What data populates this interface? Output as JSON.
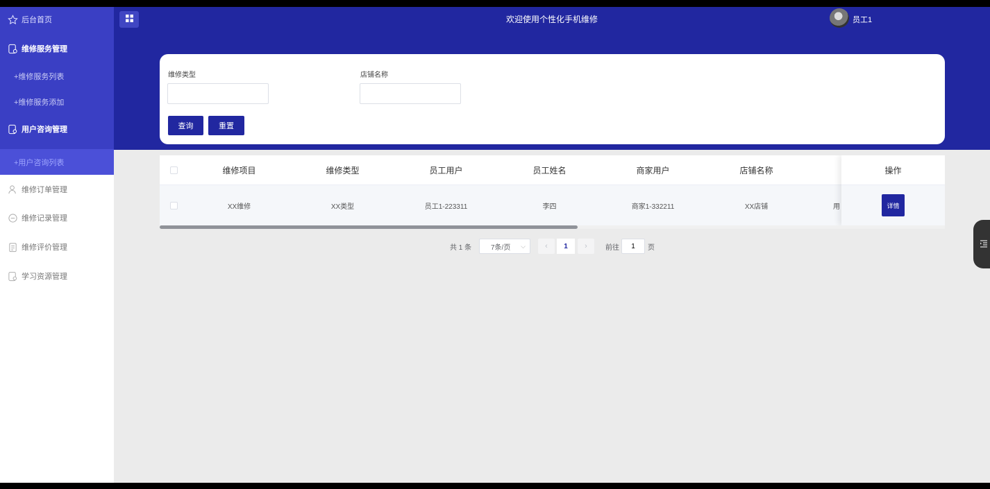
{
  "header": {
    "title": "欢迎使用个性化手机维修",
    "user_name": "员工1"
  },
  "sidebar": {
    "home": "后台首页",
    "groups": [
      {
        "label": "维修服务管理",
        "items": [
          "+维修服务列表",
          "+维修服务添加"
        ]
      },
      {
        "label": "用户咨询管理",
        "items": [
          "+用户咨询列表"
        ]
      }
    ],
    "other": [
      "维修订单管理",
      "维修记录管理",
      "维修评价管理",
      "学习资源管理"
    ]
  },
  "search": {
    "field1_label": "维修类型",
    "field1_value": "",
    "field2_label": "店铺名称",
    "field2_value": "",
    "query_button": "查询",
    "reset_button": "重置"
  },
  "table": {
    "columns": [
      "维修项目",
      "维修类型",
      "员工用户",
      "员工姓名",
      "商家用户",
      "店铺名称",
      "操作"
    ],
    "rows": [
      {
        "cells": [
          "XX维修",
          "XX类型",
          "员工1-223311",
          "李四",
          "商家1-332211",
          "XX店铺"
        ],
        "overflow_text": "用",
        "action": "详情"
      }
    ]
  },
  "pagination": {
    "total": "共 1 条",
    "page_size": "7条/页",
    "prev": "‹",
    "current": "1",
    "next": "›",
    "goto_prefix": "前往",
    "goto_value": "1",
    "goto_suffix": "页"
  },
  "colors": {
    "primary": "#2127a0",
    "sidebar_blue": "#3a3fc4",
    "background": "#ebebeb"
  }
}
